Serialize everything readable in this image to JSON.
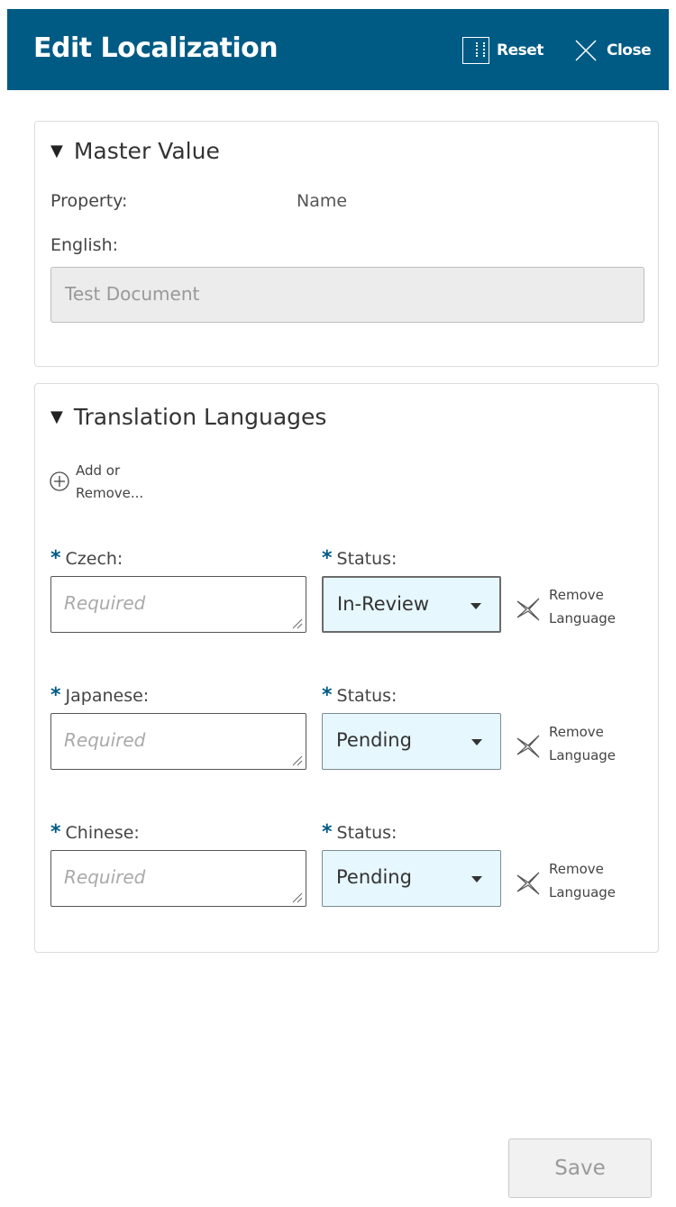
{
  "header": {
    "title": "Edit Localization",
    "reset_label": "Reset",
    "close_label": "Close",
    "background": "#005b84"
  },
  "master": {
    "title": "Master Value",
    "property_label": "Property:",
    "property_value": "Name",
    "english_label": "English:",
    "english_value": "Test Document"
  },
  "translations": {
    "title": "Translation Languages",
    "add_remove_line1": "Add or",
    "add_remove_line2": "Remove...",
    "remove_line1": "Remove",
    "remove_line2": "Language",
    "status_label": "Status:",
    "placeholder": "Required",
    "languages": [
      {
        "label": "Czech:",
        "status": "In-Review"
      },
      {
        "label": "Japanese:",
        "status": "Pending"
      },
      {
        "label": "Chinese:",
        "status": "Pending"
      }
    ]
  },
  "footer": {
    "save_label": "Save"
  },
  "colors": {
    "accent": "#005b84",
    "select_bg": "#e6f7fd"
  }
}
